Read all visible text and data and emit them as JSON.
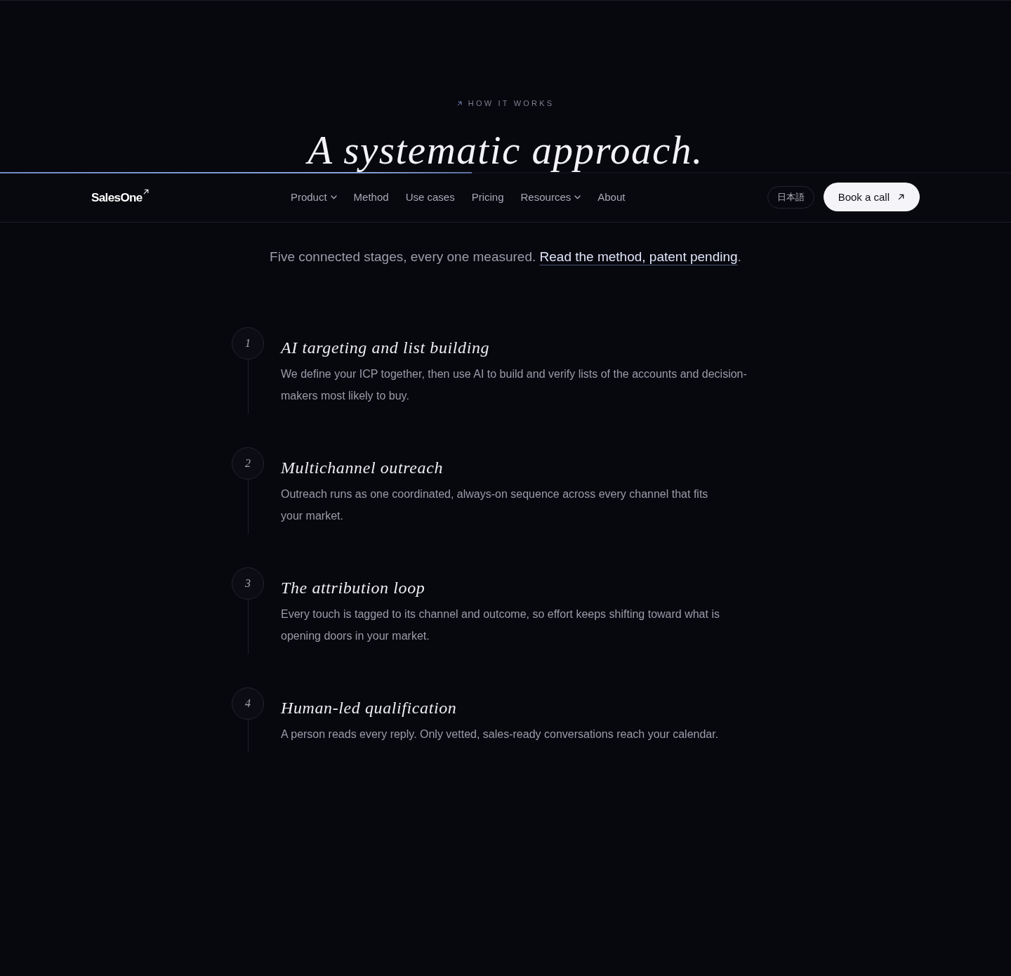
{
  "eyebrow": "HOW IT WORKS",
  "title": "A systematic approach.",
  "nav": {
    "logo": "SalesOne",
    "scroll_progress": {
      "level": 0.467
    },
    "links": [
      {
        "label": "Product",
        "has_menu": true
      },
      {
        "label": "Method",
        "has_menu": false
      },
      {
        "label": "Use cases",
        "has_menu": false
      },
      {
        "label": "Pricing",
        "has_menu": false
      },
      {
        "label": "Resources",
        "has_menu": true
      },
      {
        "label": "About",
        "has_menu": false
      }
    ],
    "language": "日本語",
    "cta": "Book a call"
  },
  "subtitle": {
    "text": "Five connected stages, every one measured.",
    "link": "Read the method, patent pending",
    "after": "."
  },
  "steps": [
    {
      "number": "1",
      "title": "AI targeting and list building",
      "description": "We define your ICP together, then use AI to build and verify lists of the accounts and decision-makers most likely to buy."
    },
    {
      "number": "2",
      "title": "Multichannel outreach",
      "description": "Outreach runs as one coordinated, always-on sequence across every channel that fits your market."
    },
    {
      "number": "3",
      "title": "The attribution loop",
      "description": "Every touch is tagged to its channel and outcome, so effort keeps shifting toward what is opening doors in your market."
    },
    {
      "number": "4",
      "title": "Human-led qualification",
      "description": "A person reads every reply. Only vetted, sales-ready conversations reach your calendar."
    }
  ]
}
